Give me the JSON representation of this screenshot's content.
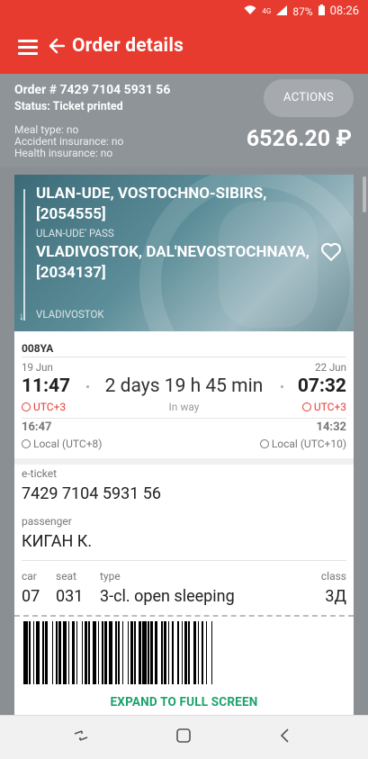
{
  "status_bar": {
    "signal": "4G",
    "battery": "87%",
    "time": "08:26"
  },
  "header": {
    "title": "Order details"
  },
  "order": {
    "number": "Order # 7429 7104 5931 56",
    "status": "Status: Ticket printed",
    "actions_label": "ACTIONS",
    "meal": "Meal type: no",
    "accident": "Accident insurance: no",
    "health": "Health insurance: no",
    "price": "6526.20 ₽"
  },
  "route": {
    "from": "ULAN-UDE, VOSTOCHNO-SIBIRS, [2054555]",
    "from_sub": "ULAN-UDE' PASS",
    "to": "VLADIVOSTOK, DAL'NEVOSTOCHNAYA, [2034137]",
    "to_sub": "VLADIVOSTOK"
  },
  "trip": {
    "train": "008YA",
    "dep_date": "19 Jun",
    "arr_date": "22 Jun",
    "dep_time": "11:47",
    "arr_time": "07:32",
    "duration": "2 days 19 h 45 min",
    "in_way": "In way",
    "dep_utc": "UTC+3",
    "arr_utc": "UTC+3",
    "dep_local_time": "16:47",
    "arr_local_time": "14:32",
    "dep_local": "Local (UTC+8)",
    "arr_local": "Local (UTC+10)"
  },
  "ticket": {
    "eticket_label": "e-ticket",
    "eticket_value": "7429 7104 5931 56",
    "passenger_label": "passenger",
    "passenger_value": "КИГАН К.",
    "car_label": "car",
    "car_value": "07",
    "seat_label": "seat",
    "seat_value": "031",
    "type_label": "type",
    "type_value": "3-cl. open sleeping",
    "class_label": "class",
    "class_value": "3Д"
  },
  "expand_label": "EXPAND TO FULL SCREEN",
  "colors": {
    "accent": "#e73b2f",
    "expand": "#1aa36a",
    "utc": "#e73b2f"
  }
}
